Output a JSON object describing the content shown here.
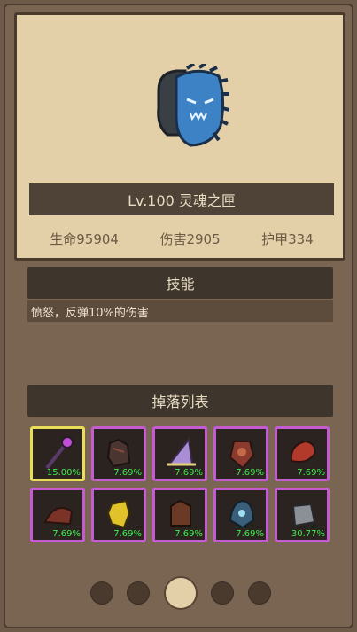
{
  "monster": {
    "name": "Lv.100 灵魂之匣",
    "stats": [
      {
        "label": "生命95904"
      },
      {
        "label": "伤害2905"
      },
      {
        "label": "护甲334"
      }
    ]
  },
  "skill": {
    "title": "技能",
    "description": "愤怒，反弹10%的伤害"
  },
  "drops": {
    "title": "掉落列表",
    "items": [
      {
        "icon": "wand-icon",
        "percent": "15.00%",
        "rarity": "legendary"
      },
      {
        "icon": "chest-armor-icon",
        "percent": "7.69%",
        "rarity": "epic"
      },
      {
        "icon": "wizard-hat-icon",
        "percent": "7.69%",
        "rarity": "epic"
      },
      {
        "icon": "shield-icon",
        "percent": "7.69%",
        "rarity": "epic"
      },
      {
        "icon": "horn-icon",
        "percent": "7.69%",
        "rarity": "epic"
      },
      {
        "icon": "hood-icon",
        "percent": "7.69%",
        "rarity": "epic"
      },
      {
        "icon": "gold-gauntlet-icon",
        "percent": "7.69%",
        "rarity": "epic"
      },
      {
        "icon": "leather-armor-icon",
        "percent": "7.69%",
        "rarity": "epic"
      },
      {
        "icon": "helmet-icon",
        "percent": "7.69%",
        "rarity": "epic"
      },
      {
        "icon": "iron-gauntlet-icon",
        "percent": "30.77%",
        "rarity": "epic"
      }
    ]
  },
  "pager": {
    "pages": 5,
    "current": 3
  },
  "colors": {
    "epic_border": "#c45bd0",
    "legendary_border": "#e8de5a",
    "percent_text": "#3ef04a"
  }
}
